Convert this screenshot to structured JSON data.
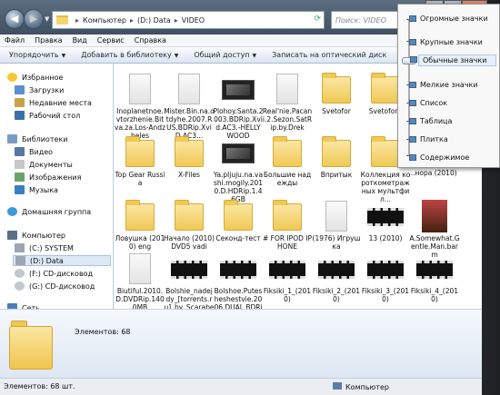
{
  "address": {
    "crumbs": [
      "Компьютер",
      "(D:) Data",
      "VIDEO"
    ]
  },
  "search": {
    "placeholder": "Поиск: VIDEO"
  },
  "menubar": [
    "Файл",
    "Правка",
    "Вид",
    "Сервис",
    "Справка"
  ],
  "toolbar": [
    "Упорядочить",
    "Добавить в библиотеку",
    "Общий доступ",
    "Записать на оптический диск"
  ],
  "sidebar": {
    "favorites": "Избранное",
    "downloads": "Загрузки",
    "recent": "Недавние места",
    "desktop": "Рабочий стол",
    "libraries": "Библиотеки",
    "video": "Видео",
    "documents": "Документы",
    "images": "Изображения",
    "music": "Музыка",
    "homegroup": "Домашняя группа",
    "computer": "Компьютер",
    "c": "(C:) SYSTEM",
    "d": "(D:) Data",
    "f": "(F:) CD-дисковод",
    "g": "(G:) CD-дисковод",
    "network": "Сеть"
  },
  "files": [
    {
      "name": "Inoplanetnoe.vtorzhenie.Bitva.za.Los-Andzheles",
      "t": "doc"
    },
    {
      "name": "Mister.Bin.na.otdyhe.2007.RUS.BDRip.XviD.AC3...",
      "t": "doc"
    },
    {
      "name": "Plohoy.Santa.2003.BDRip.Xvid.AC3.-HELLYWOOD",
      "t": "vid"
    },
    {
      "name": "Real'nie.Pacani.2.Sezon.SatRip.by.Drek",
      "t": "doc"
    },
    {
      "name": "Svetofor",
      "t": "folder"
    },
    {
      "name": "Svetofor2",
      "t": "folder"
    },
    {
      "name": "Top Gear Russia",
      "t": "folder"
    },
    {
      "name": "X-Files",
      "t": "folder"
    },
    {
      "name": "Ya.pljuju.na.vashi.mogily.2010.D.HDRip.1.46GB",
      "t": "vid"
    },
    {
      "name": "Большие надежды",
      "t": "folder"
    },
    {
      "name": "Впритык",
      "t": "folder"
    },
    {
      "name": "Коллекция короткометражных мультфил...",
      "t": "folder"
    },
    {
      "name": "Ловушка (2010) eng",
      "t": "folder"
    },
    {
      "name": "Начало (2010) DVD5 vadi",
      "t": "folder"
    },
    {
      "name": "Секонд-тест",
      "t": "folder"
    },
    {
      "name": "# FOR IPOD IPHONE",
      "t": "folder"
    },
    {
      "name": "(1976) Игрушка",
      "t": "doc"
    },
    {
      "name": "13 (2010)",
      "t": "vidsm"
    },
    {
      "name": "A.Somewhat.Gentle.Man.barm",
      "t": "poster"
    },
    {
      "name": "Biutiful.2010.D.DVDRip.1400MB",
      "t": "doc"
    },
    {
      "name": "Bolshie_nadejdy_[torrents.ru]_by_Scarabey",
      "t": "vidsm"
    },
    {
      "name": "Bolshoe.Putesheshestvie.2006.DUAL.BDRip.XviD.A...",
      "t": "vidsm"
    },
    {
      "name": "Fiksiki_1_(2010)",
      "t": "vidsm"
    },
    {
      "name": "Fiksiki_2_(2010)",
      "t": "vidsm"
    },
    {
      "name": "Fiksiki_3_(2010)",
      "t": "vidsm"
    },
    {
      "name": "Fiksiki_4_(2010)",
      "t": "vidsm"
    }
  ],
  "partial_row2_last": "...нора (2010)",
  "details": {
    "count": "Элементов: 68"
  },
  "status": {
    "left": "Элементов: 68 шт.",
    "right": "Компьютер"
  },
  "viewmenu": [
    "Огромные значки",
    "Крупные значки",
    "Обычные значки",
    "Мелкие значки",
    "Список",
    "Таблица",
    "Плитка",
    "Содержимое"
  ]
}
